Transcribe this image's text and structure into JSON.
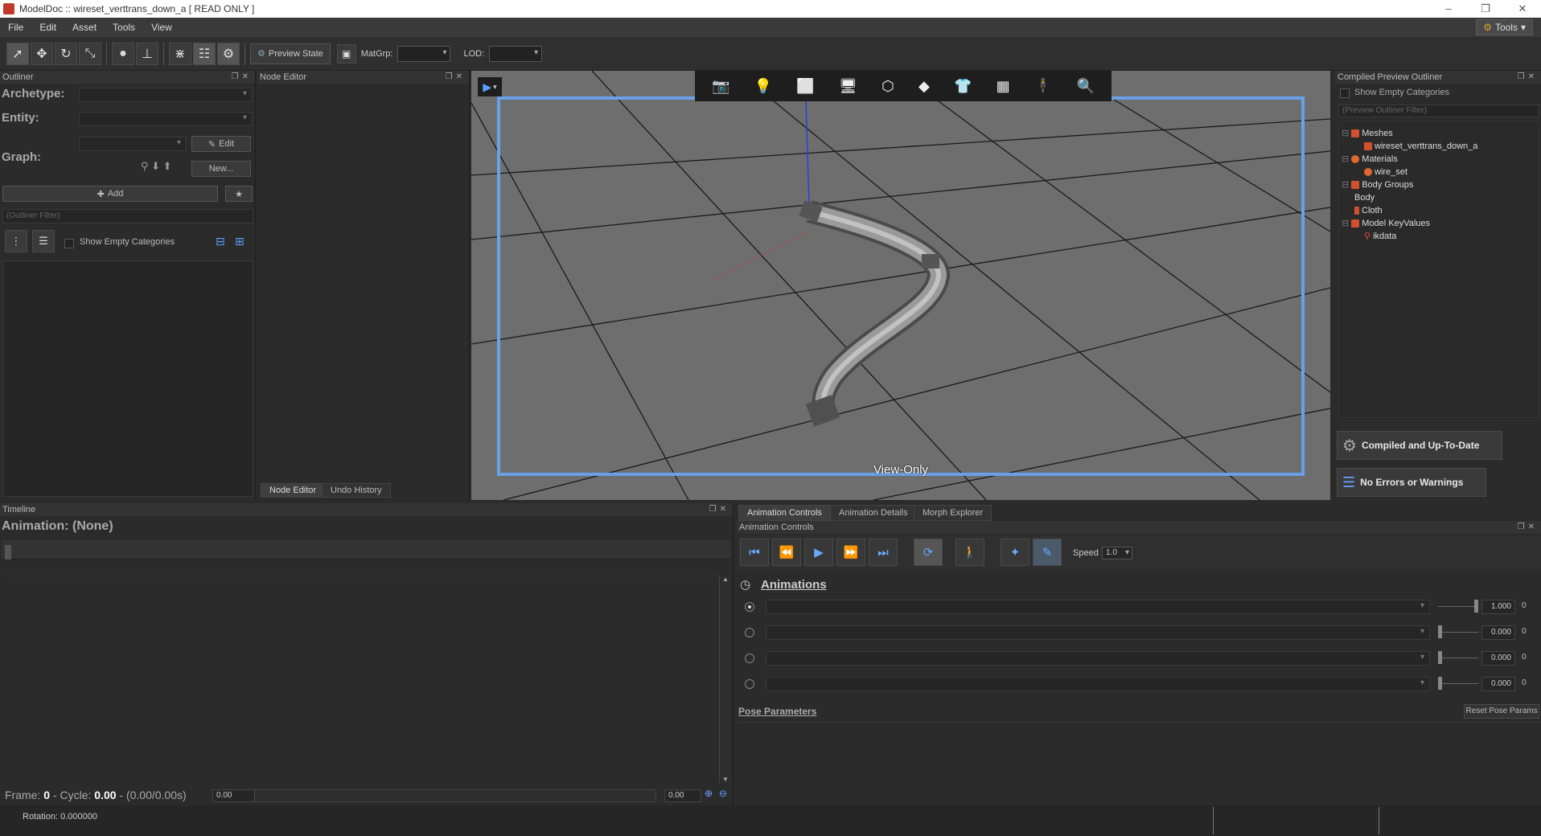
{
  "titlebar": {
    "title": "ModelDoc :: wireset_verttrans_down_a [ READ ONLY ]",
    "minimize": "–",
    "restore": "❐",
    "close": "✕"
  },
  "menu": {
    "items": [
      "File",
      "Edit",
      "Asset",
      "Tools",
      "View"
    ],
    "tools_right": "Tools"
  },
  "toolbar": {
    "preview_state": "Preview State",
    "matgrp_label": "MatGrp:",
    "lod_label": "LOD:"
  },
  "outliner": {
    "title": "Outliner",
    "archetype_label": "Archetype:",
    "entity_label": "Entity:",
    "graph_label": "Graph:",
    "edit_button": "Edit",
    "new_button": "New...",
    "add_button": "Add",
    "filter_placeholder": "(Outliner Filter)",
    "show_empty": "Show Empty Categories"
  },
  "node_editor": {
    "title": "Node Editor",
    "tab_node_editor": "Node Editor",
    "tab_undo_history": "Undo History"
  },
  "viewport": {
    "view_only": "View-Only"
  },
  "compiled_outliner": {
    "title": "Compiled Preview Outliner",
    "show_empty": "Show Empty Categories",
    "filter_placeholder": "(Preview Outliner Filter)",
    "tree": {
      "meshes": "Meshes",
      "mesh_item": "wireset_verttrans_down_a",
      "materials": "Materials",
      "material_item": "wire_set",
      "body_groups": "Body Groups",
      "body": "Body",
      "cloth": "Cloth",
      "model_keyvalues": "Model KeyValues",
      "ikdata": "ikdata"
    },
    "status_compiled": "Compiled and Up-To-Date",
    "status_errors": "No Errors or Warnings"
  },
  "timeline": {
    "title": "Timeline",
    "animation_label": "Animation: (None)",
    "frame_prefix": "Frame: ",
    "frame_value": "0",
    "cycle_prefix": " - Cycle: ",
    "cycle_value": "0.00",
    "duration_text": " - (0.00/0.00s)",
    "field_left": "0.00",
    "field_right": "0.00"
  },
  "anim_controls": {
    "tabs": [
      "Animation Controls",
      "Animation Details",
      "Morph Explorer"
    ],
    "title": "Animation Controls",
    "speed_label": "Speed",
    "speed_value": "1.0",
    "animations_heading": "Animations",
    "rows": [
      {
        "value": "1.000",
        "suffix": "0",
        "level": 1.0
      },
      {
        "value": "0.000",
        "suffix": "0",
        "level": 0.0
      },
      {
        "value": "0.000",
        "suffix": "0",
        "level": 0.0
      },
      {
        "value": "0.000",
        "suffix": "0",
        "level": 0.0
      }
    ],
    "pose_parameters": "Pose Parameters",
    "reset_pose": "Reset Pose Params"
  },
  "statusbar": {
    "rotation": "Rotation: 0.000000"
  },
  "colors": {
    "accent_blue": "#5aa0ff",
    "frame_border": "#6aa0e8",
    "viewport_bg": "#6e6e6e"
  }
}
